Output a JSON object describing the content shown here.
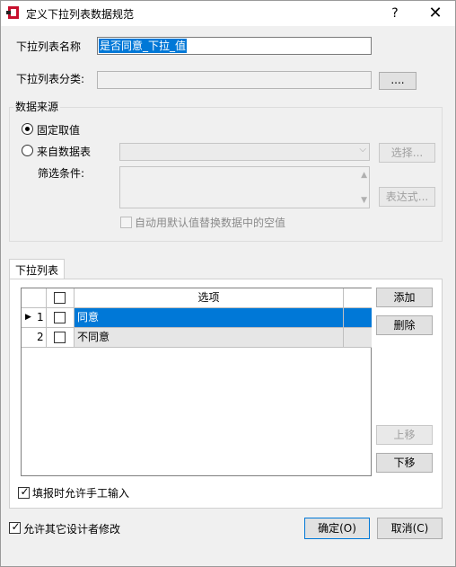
{
  "window": {
    "title": "定义下拉列表数据规范",
    "help_button": "?",
    "close_button": "✕"
  },
  "form": {
    "name_label": "下拉列表名称",
    "name_value": "是否同意_下拉_值",
    "category_label": "下拉列表分类:",
    "category_value": "",
    "browse_button": "....",
    "data_source": {
      "group_title": "数据来源",
      "fixed_label": "固定取值",
      "fixed_selected": true,
      "table_label": "来自数据表",
      "select_button": "选择...",
      "filter_label": "筛选条件:",
      "expression_button": "表达式...",
      "default_replace_label": "自动用默认值替换数据中的空值"
    }
  },
  "list_tab": {
    "tab_label": "下拉列表",
    "header_option": "选项",
    "rows": [
      {
        "index": "1",
        "value": "同意",
        "selected": true,
        "current": true
      },
      {
        "index": "2",
        "value": "不同意",
        "selected": false,
        "current": false
      }
    ],
    "add_button": "添加",
    "delete_button": "删除",
    "up_button": "上移",
    "down_button": "下移",
    "manual_input_label": "填报时允许手工输入",
    "manual_input_checked": true
  },
  "footer": {
    "allow_modify_label": "允许其它设计者修改",
    "allow_modify_checked": true,
    "ok_button": "确定(O)",
    "cancel_button": "取消(C)"
  },
  "colors": {
    "selection_blue": "#0078d7",
    "dialog_bg": "#f0f0f0"
  }
}
